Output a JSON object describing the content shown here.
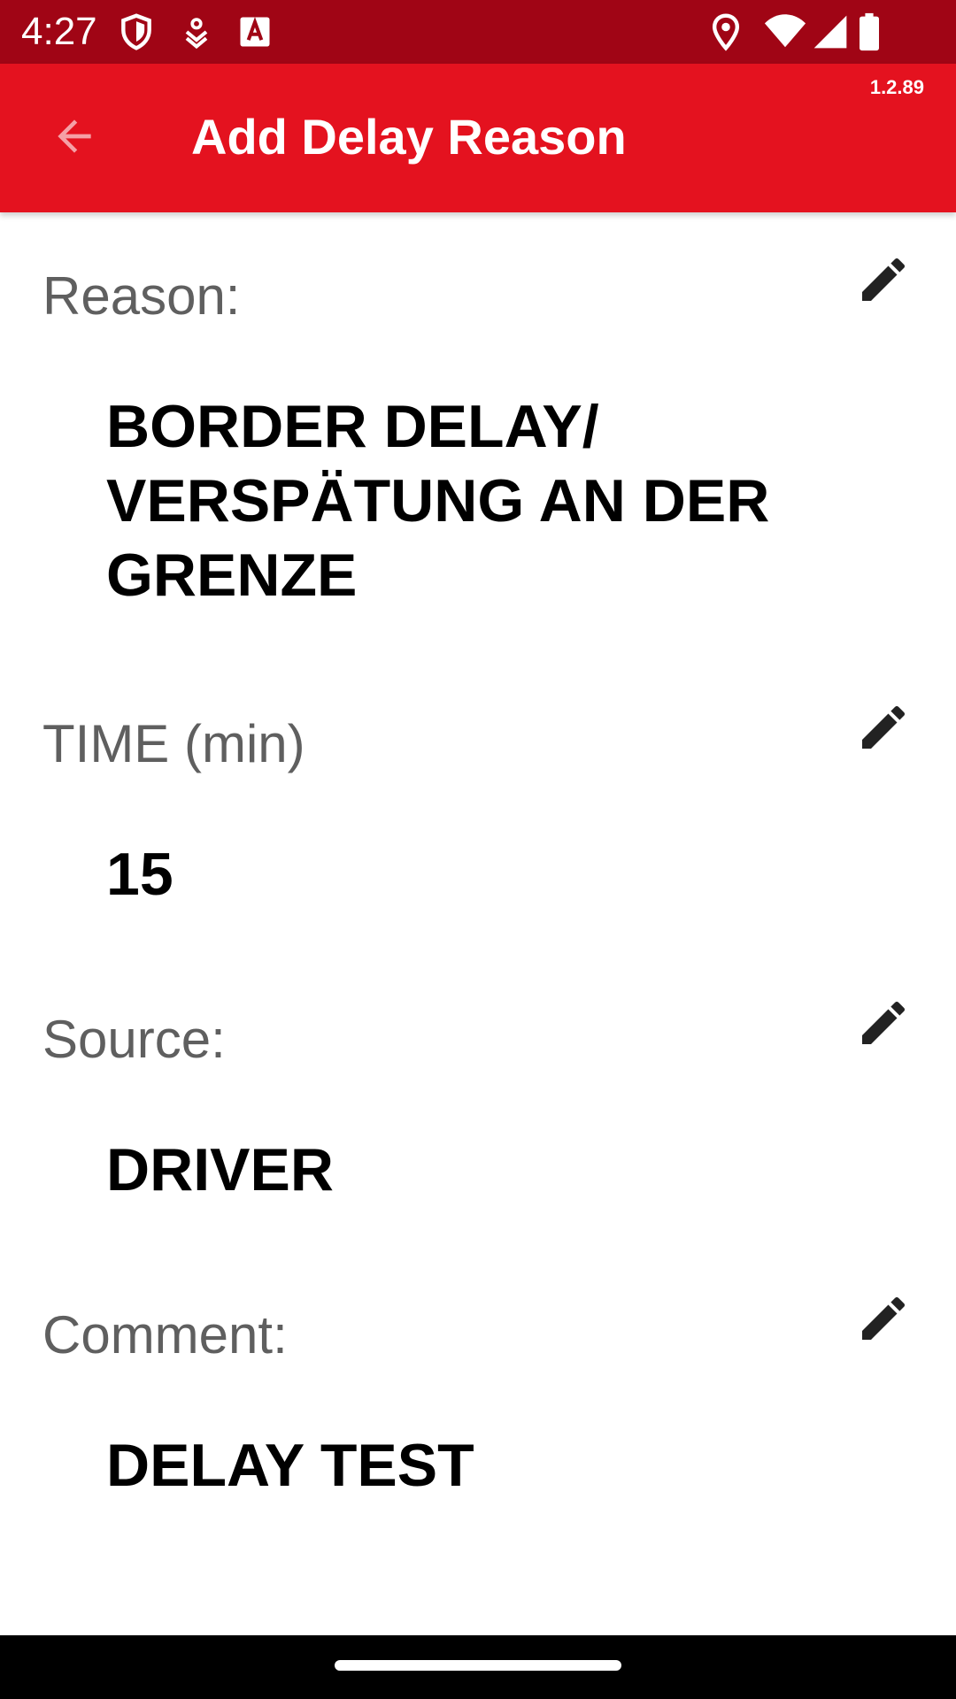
{
  "status_bar": {
    "time": "4:27",
    "icons": [
      "shield-icon",
      "download-icon",
      "font-a-icon",
      "location-icon",
      "wifi-icon",
      "signal-icon",
      "battery-icon"
    ],
    "background": "#a00515"
  },
  "app_bar": {
    "title": "Add Delay Reason",
    "version": "1.2.89",
    "back_icon": "arrow-back-icon",
    "background": "#e4121f"
  },
  "fields": {
    "reason": {
      "label": "Reason:",
      "value": "BORDER DELAY/ VERSPÄTUNG AN DER GRENZE",
      "edit_icon": "pencil-icon"
    },
    "time": {
      "label": "TIME (min)",
      "value": "15",
      "edit_icon": "pencil-icon"
    },
    "source": {
      "label": "Source:",
      "value": "DRIVER",
      "edit_icon": "pencil-icon"
    },
    "comment": {
      "label": "Comment:",
      "value": "DELAY TEST",
      "edit_icon": "pencil-icon"
    }
  },
  "colors": {
    "label": "#5f5f5f",
    "value": "#000000",
    "back_arrow": "#f5a0a6"
  }
}
